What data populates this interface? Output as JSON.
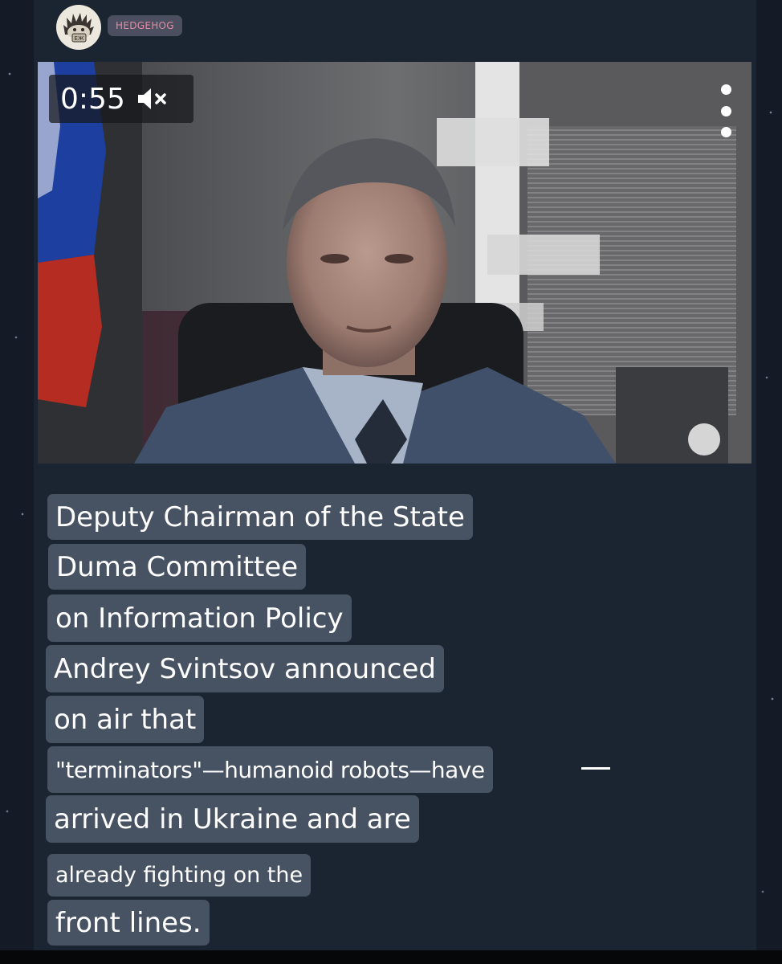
{
  "channel": {
    "avatar_label": "ЕЖ",
    "name": "HEDGEHOG"
  },
  "video": {
    "time": "0:55",
    "muted": true,
    "icons": [
      "speaker-muted-icon",
      "more-vertical-icon"
    ]
  },
  "caption": {
    "lines": [
      "Deputy Chairman of the State",
      "Duma Committee",
      "on Information Policy",
      "Andrey Svintsov announced",
      "on air that",
      "\"terminators\"—humanoid robots—have",
      "arrived in Ukraine and are",
      "already fighting on the",
      "front lines."
    ]
  },
  "colors": {
    "panel": "#1b2532",
    "caption_bg": "#475262",
    "tag_text": "#e08da4",
    "tag_bg": "#4b4f5f"
  }
}
